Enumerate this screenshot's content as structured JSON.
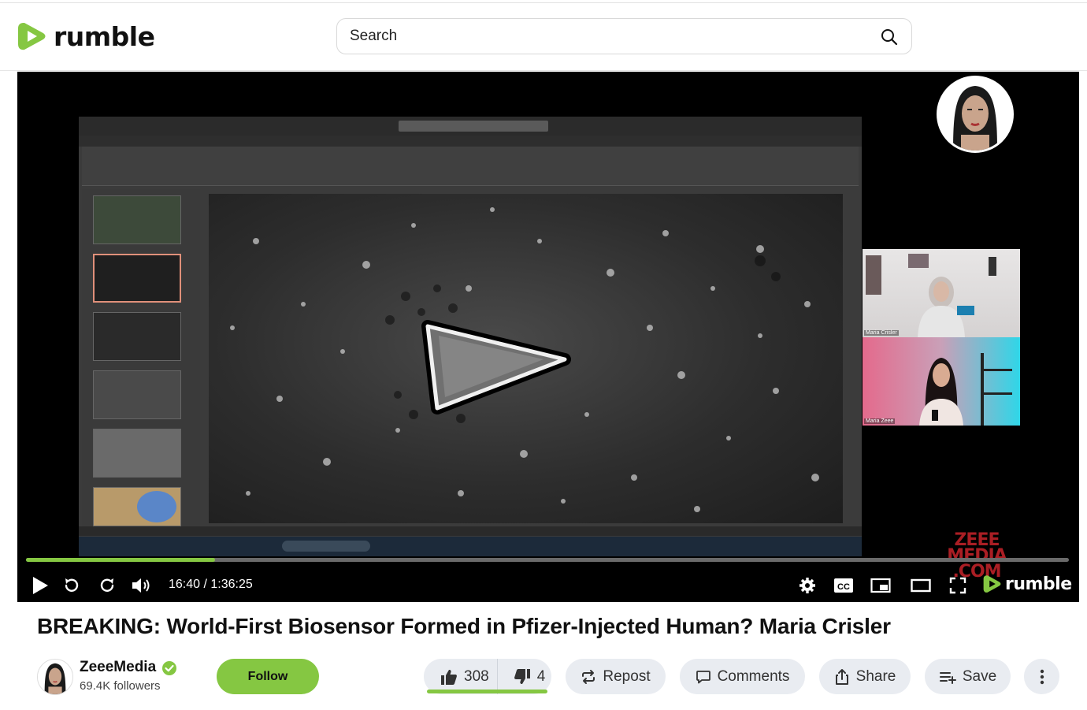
{
  "header": {
    "logo_text": "rumble",
    "search_placeholder": "Search"
  },
  "player": {
    "progress_fraction": 0.1812,
    "time_display": "16:40 / 1:36:25",
    "brand_logo": "rumble",
    "watermark_lines": [
      "ZEEE",
      "MEDIA",
      ".COM"
    ],
    "cam_labels": [
      "Maria Crisler",
      "Maria Zeee"
    ],
    "accent_color": "#85c742"
  },
  "video": {
    "title": "BREAKING: World-First Biosensor Formed in Pfizer-Injected Human? Maria Crisler"
  },
  "channel": {
    "name": "ZeeeMedia",
    "followers": "69.4K followers",
    "verified": true,
    "follow_label": "Follow"
  },
  "actions": {
    "likes": "308",
    "dislikes": "4",
    "like_ratio": 0.987,
    "repost": "Repost",
    "comments": "Comments",
    "share": "Share",
    "save": "Save"
  },
  "icons": [
    "search-icon",
    "play-icon",
    "rewind-icon",
    "forward-icon",
    "volume-icon",
    "settings-icon",
    "cc-icon",
    "pip-icon",
    "theater-icon",
    "fullscreen-icon",
    "thumbs-up-icon",
    "thumbs-down-icon",
    "repost-icon",
    "comment-icon",
    "share-icon",
    "save-icon",
    "more-icon",
    "verified-icon"
  ]
}
